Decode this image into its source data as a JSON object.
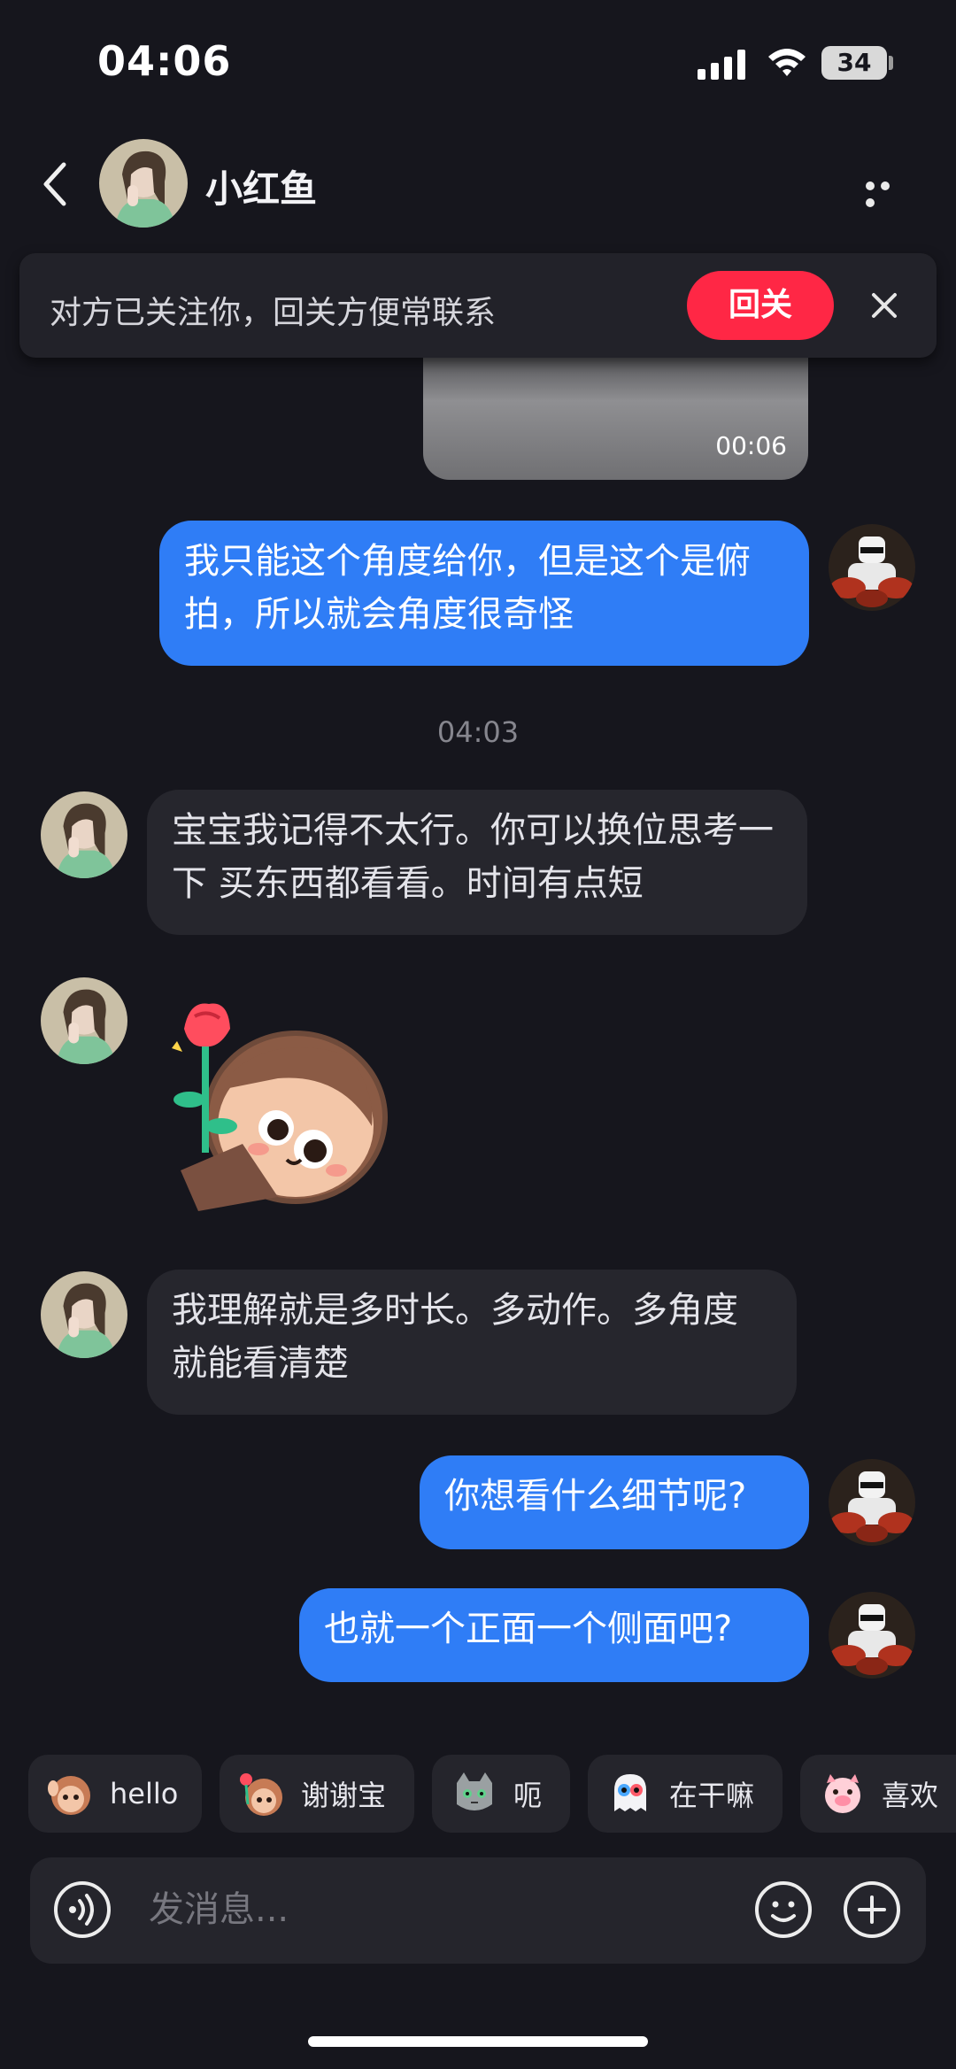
{
  "status_bar": {
    "time": "04:06",
    "battery": "34"
  },
  "header": {
    "contact_name": "小红鱼"
  },
  "follow_banner": {
    "text": "对方已关注你，回关方便常联系",
    "button_label": "回关"
  },
  "video": {
    "duration": "00:06"
  },
  "messages": [
    {
      "from": "me",
      "text": "我只能这个角度给你，但是这个是俯拍，所以就会角度很奇怪"
    },
    {
      "from": "them",
      "text": "宝宝我记得不太行。你可以换位思考一下 买东西都看看。时间有点短"
    },
    {
      "from": "them",
      "type": "sticker",
      "sticker": "flower-sticker"
    },
    {
      "from": "them",
      "text": "我理解就是多时长。多动作。多角度就能看清楚"
    },
    {
      "from": "me",
      "text": "你想看什么细节呢?"
    },
    {
      "from": "me",
      "text": "也就一个正面一个侧面吧?"
    }
  ],
  "timestamp": "04:03",
  "quick_replies": [
    {
      "label": "hello",
      "icon": "monkey-wave-icon"
    },
    {
      "label": "谢谢宝",
      "icon": "monkey-flower-icon"
    },
    {
      "label": "呃",
      "icon": "cat-icon"
    },
    {
      "label": "在干嘛",
      "icon": "ghost-icon"
    },
    {
      "label": "喜欢",
      "icon": "pig-icon"
    }
  ],
  "composer": {
    "placeholder": "发消息..."
  },
  "colors": {
    "accent_red": "#ff2745",
    "bubble_blue": "#2f7df6",
    "background": "#16161d"
  }
}
